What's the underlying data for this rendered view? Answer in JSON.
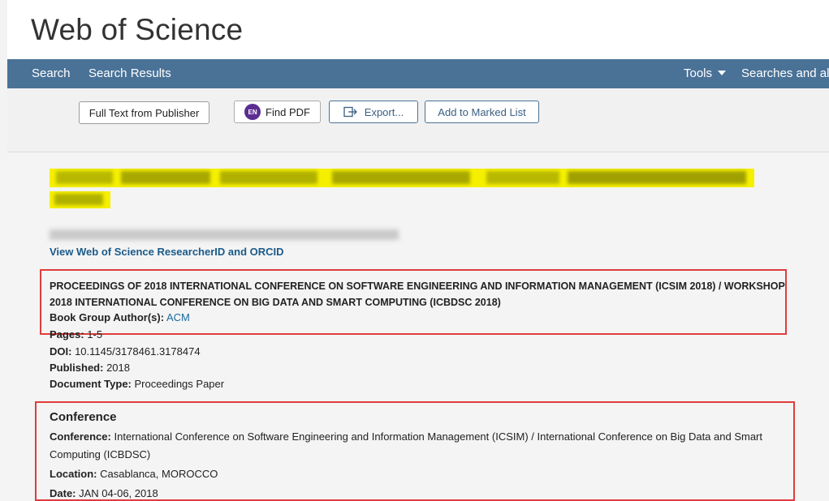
{
  "header": {
    "brand": "Web of Science"
  },
  "nav": {
    "search": "Search",
    "search_results": "Search Results",
    "tools": "Tools",
    "searches_alerts": "Searches and ale"
  },
  "toolbar": {
    "full_text": "Full Text from Publisher",
    "find_pdf_badge": "EN",
    "find_pdf": "Find PDF",
    "export": "Export...",
    "marked_list": "Add to Marked List"
  },
  "record": {
    "researcher_link": "View Web of Science ResearcherID and ORCID",
    "proceedings_title": "PROCEEDINGS OF 2018 INTERNATIONAL CONFERENCE ON SOFTWARE ENGINEERING AND INFORMATION MANAGEMENT (ICSIM 2018) / WORKSHOP 2018 INTERNATIONAL CONFERENCE ON BIG DATA AND SMART COMPUTING (ICBDSC 2018)",
    "book_group_label": "Book Group Author(s):",
    "book_group_value": "ACM",
    "pages_label": "Pages:",
    "pages_value": "1-5",
    "doi_label": "DOI:",
    "doi_value": "10.1145/3178461.3178474",
    "published_label": "Published:",
    "published_value": "2018",
    "doctype_label": "Document Type:",
    "doctype_value": "Proceedings Paper"
  },
  "conference": {
    "heading": "Conference",
    "conf_label": "Conference:",
    "conf_value": "International Conference on Software Engineering and Information Management (ICSIM) / International Conference on Big Data and Smart Computing (ICBDSC)",
    "location_label": "Location:",
    "location_value": "Casablanca, MOROCCO",
    "date_label": "Date:",
    "date_value": "JAN 04-06, 2018"
  },
  "colors": {
    "nav_bg": "#4a7297",
    "highlight": "#f6f000",
    "annotation_red": "#e03c3c"
  }
}
